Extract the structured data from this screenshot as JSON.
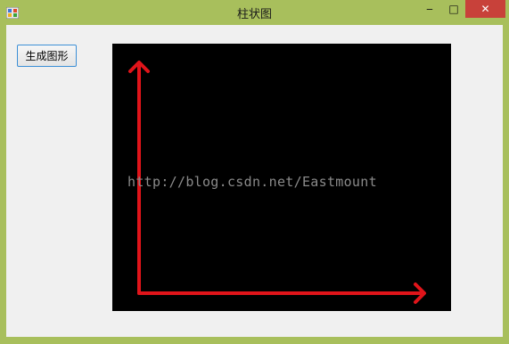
{
  "window": {
    "title": "柱状图",
    "controls": {
      "minimize": "‒",
      "maximize": "□",
      "close": "✕"
    }
  },
  "toolbar": {
    "generate_label": "生成图形"
  },
  "canvas": {
    "background": "#000000",
    "axis_color": "#e0141a",
    "watermark": "http://blog.csdn.net/Eastmount"
  },
  "colors": {
    "frame": "#a8bf5c",
    "close": "#c8413a",
    "button_border": "#3c8fd6"
  }
}
